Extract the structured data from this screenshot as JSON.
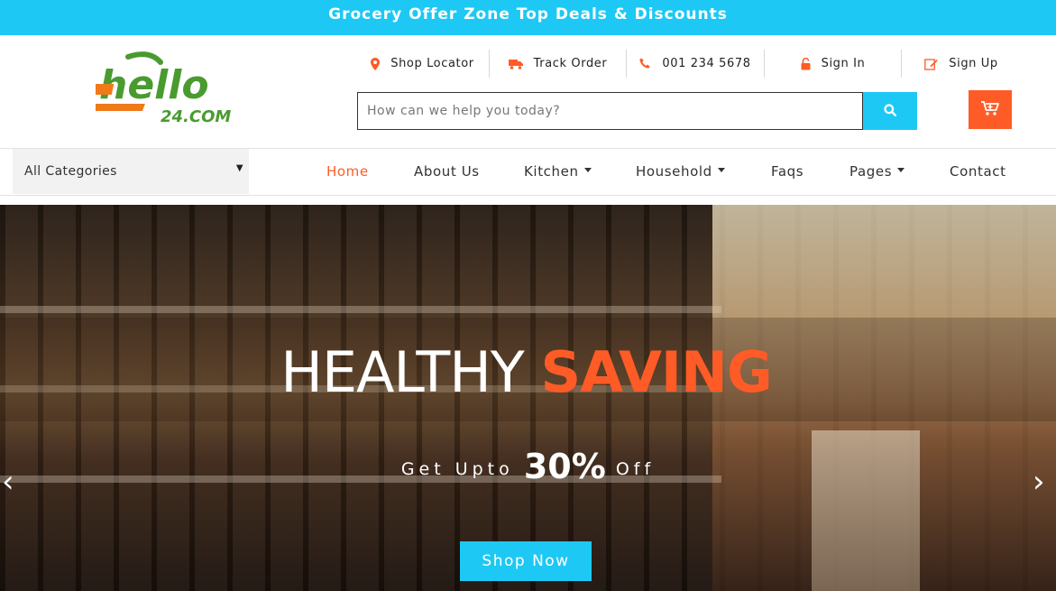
{
  "topbar": {
    "text": "Grocery Offer Zone Top Deals & Discounts"
  },
  "logo": {
    "main": "hello",
    "sub": "24.COM",
    "colors": {
      "green": "#4a9b2f",
      "orange": "#f07a1a"
    }
  },
  "utility": [
    {
      "label": "Shop Locator",
      "icon": "map-marker-icon"
    },
    {
      "label": "Track Order",
      "icon": "truck-icon"
    },
    {
      "label": "001 234 5678",
      "icon": "phone-icon"
    },
    {
      "label": "Sign In",
      "icon": "unlock-icon"
    },
    {
      "label": "Sign Up",
      "icon": "edit-icon"
    }
  ],
  "search": {
    "placeholder": "How can we help you today?",
    "value": ""
  },
  "nav": {
    "category_select": "All Categories",
    "items": [
      {
        "label": "Home",
        "active": true,
        "dropdown": false
      },
      {
        "label": "About Us",
        "active": false,
        "dropdown": false
      },
      {
        "label": "Kitchen",
        "active": false,
        "dropdown": true
      },
      {
        "label": "Household",
        "active": false,
        "dropdown": true
      },
      {
        "label": "Faqs",
        "active": false,
        "dropdown": false
      },
      {
        "label": "Pages",
        "active": false,
        "dropdown": true
      },
      {
        "label": "Contact",
        "active": false,
        "dropdown": false
      }
    ]
  },
  "hero": {
    "title_plain": "HEALTHY",
    "title_accent": "SAVING",
    "sub_prefix": "Get Upto",
    "sub_big": "30%",
    "sub_suffix": "Off",
    "button": "Shop Now"
  },
  "colors": {
    "accent_blue": "#1ec8f4",
    "accent_orange": "#ff5b26"
  }
}
